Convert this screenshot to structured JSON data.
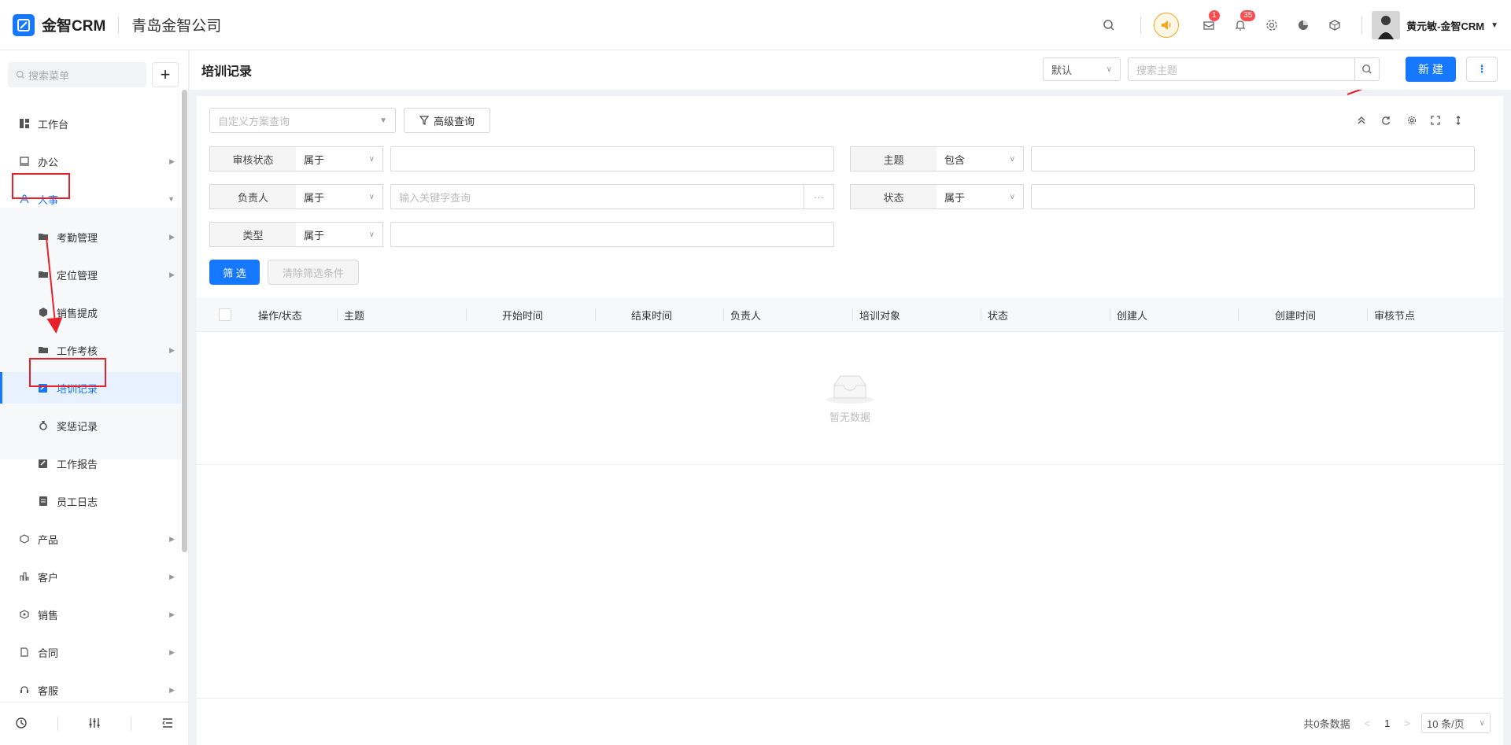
{
  "brand": {
    "name": "金智CRM",
    "company": "青岛金智公司"
  },
  "topbar": {
    "mail_badge": "1",
    "bell_badge": "35",
    "user_name": "黄元敏-金智CRM"
  },
  "sidebar": {
    "search_placeholder": "搜索菜单",
    "add_label": "+",
    "items": [
      {
        "label": "工作台",
        "icon": "dashboard-icon"
      },
      {
        "label": "办公",
        "icon": "office-icon"
      },
      {
        "label": "人事",
        "icon": "hr-icon"
      },
      {
        "label": "考勤管理",
        "icon": "folder-icon"
      },
      {
        "label": "定位管理",
        "icon": "folder-icon"
      },
      {
        "label": "销售提成",
        "icon": "commission-icon"
      },
      {
        "label": "工作考核",
        "icon": "folder-icon"
      },
      {
        "label": "培训记录",
        "icon": "training-icon"
      },
      {
        "label": "奖惩记录",
        "icon": "medal-icon"
      },
      {
        "label": "工作报告",
        "icon": "report-icon"
      },
      {
        "label": "员工日志",
        "icon": "log-icon"
      },
      {
        "label": "产品",
        "icon": "product-icon"
      },
      {
        "label": "客户",
        "icon": "customer-icon"
      },
      {
        "label": "销售",
        "icon": "sales-icon"
      },
      {
        "label": "合同",
        "icon": "contract-icon"
      },
      {
        "label": "客服",
        "icon": "service-icon"
      }
    ]
  },
  "header": {
    "title": "培训记录",
    "view_select": "默认",
    "search_placeholder": "搜索主题",
    "new_button": "新 建",
    "more": "⋮"
  },
  "filters": {
    "scheme_placeholder": "自定义方案查询",
    "advanced_label": "高级查询",
    "rows": [
      {
        "label": "审核状态",
        "op": "属于",
        "value": ""
      },
      {
        "label": "主题",
        "op": "包含",
        "value": ""
      },
      {
        "label": "负责人",
        "op": "属于",
        "value": "输入关键字查询",
        "more": "···"
      },
      {
        "label": "状态",
        "op": "属于",
        "value": ""
      },
      {
        "label": "类型",
        "op": "属于",
        "value": ""
      }
    ],
    "filter_button": "筛 选",
    "clear_button": "清除筛选条件"
  },
  "table": {
    "columns": [
      "操作/状态",
      "主题",
      "开始时间",
      "结束时间",
      "负责人",
      "培训对象",
      "状态",
      "创建人",
      "创建时间",
      "审核节点"
    ],
    "empty_text": "暂无数据"
  },
  "pagination": {
    "total_text": "共0条数据",
    "prev": "<",
    "page": "1",
    "next": ">",
    "page_size": "10 条/页"
  },
  "colors": {
    "accent": "#1677ff",
    "annotation": "#e8202a"
  }
}
